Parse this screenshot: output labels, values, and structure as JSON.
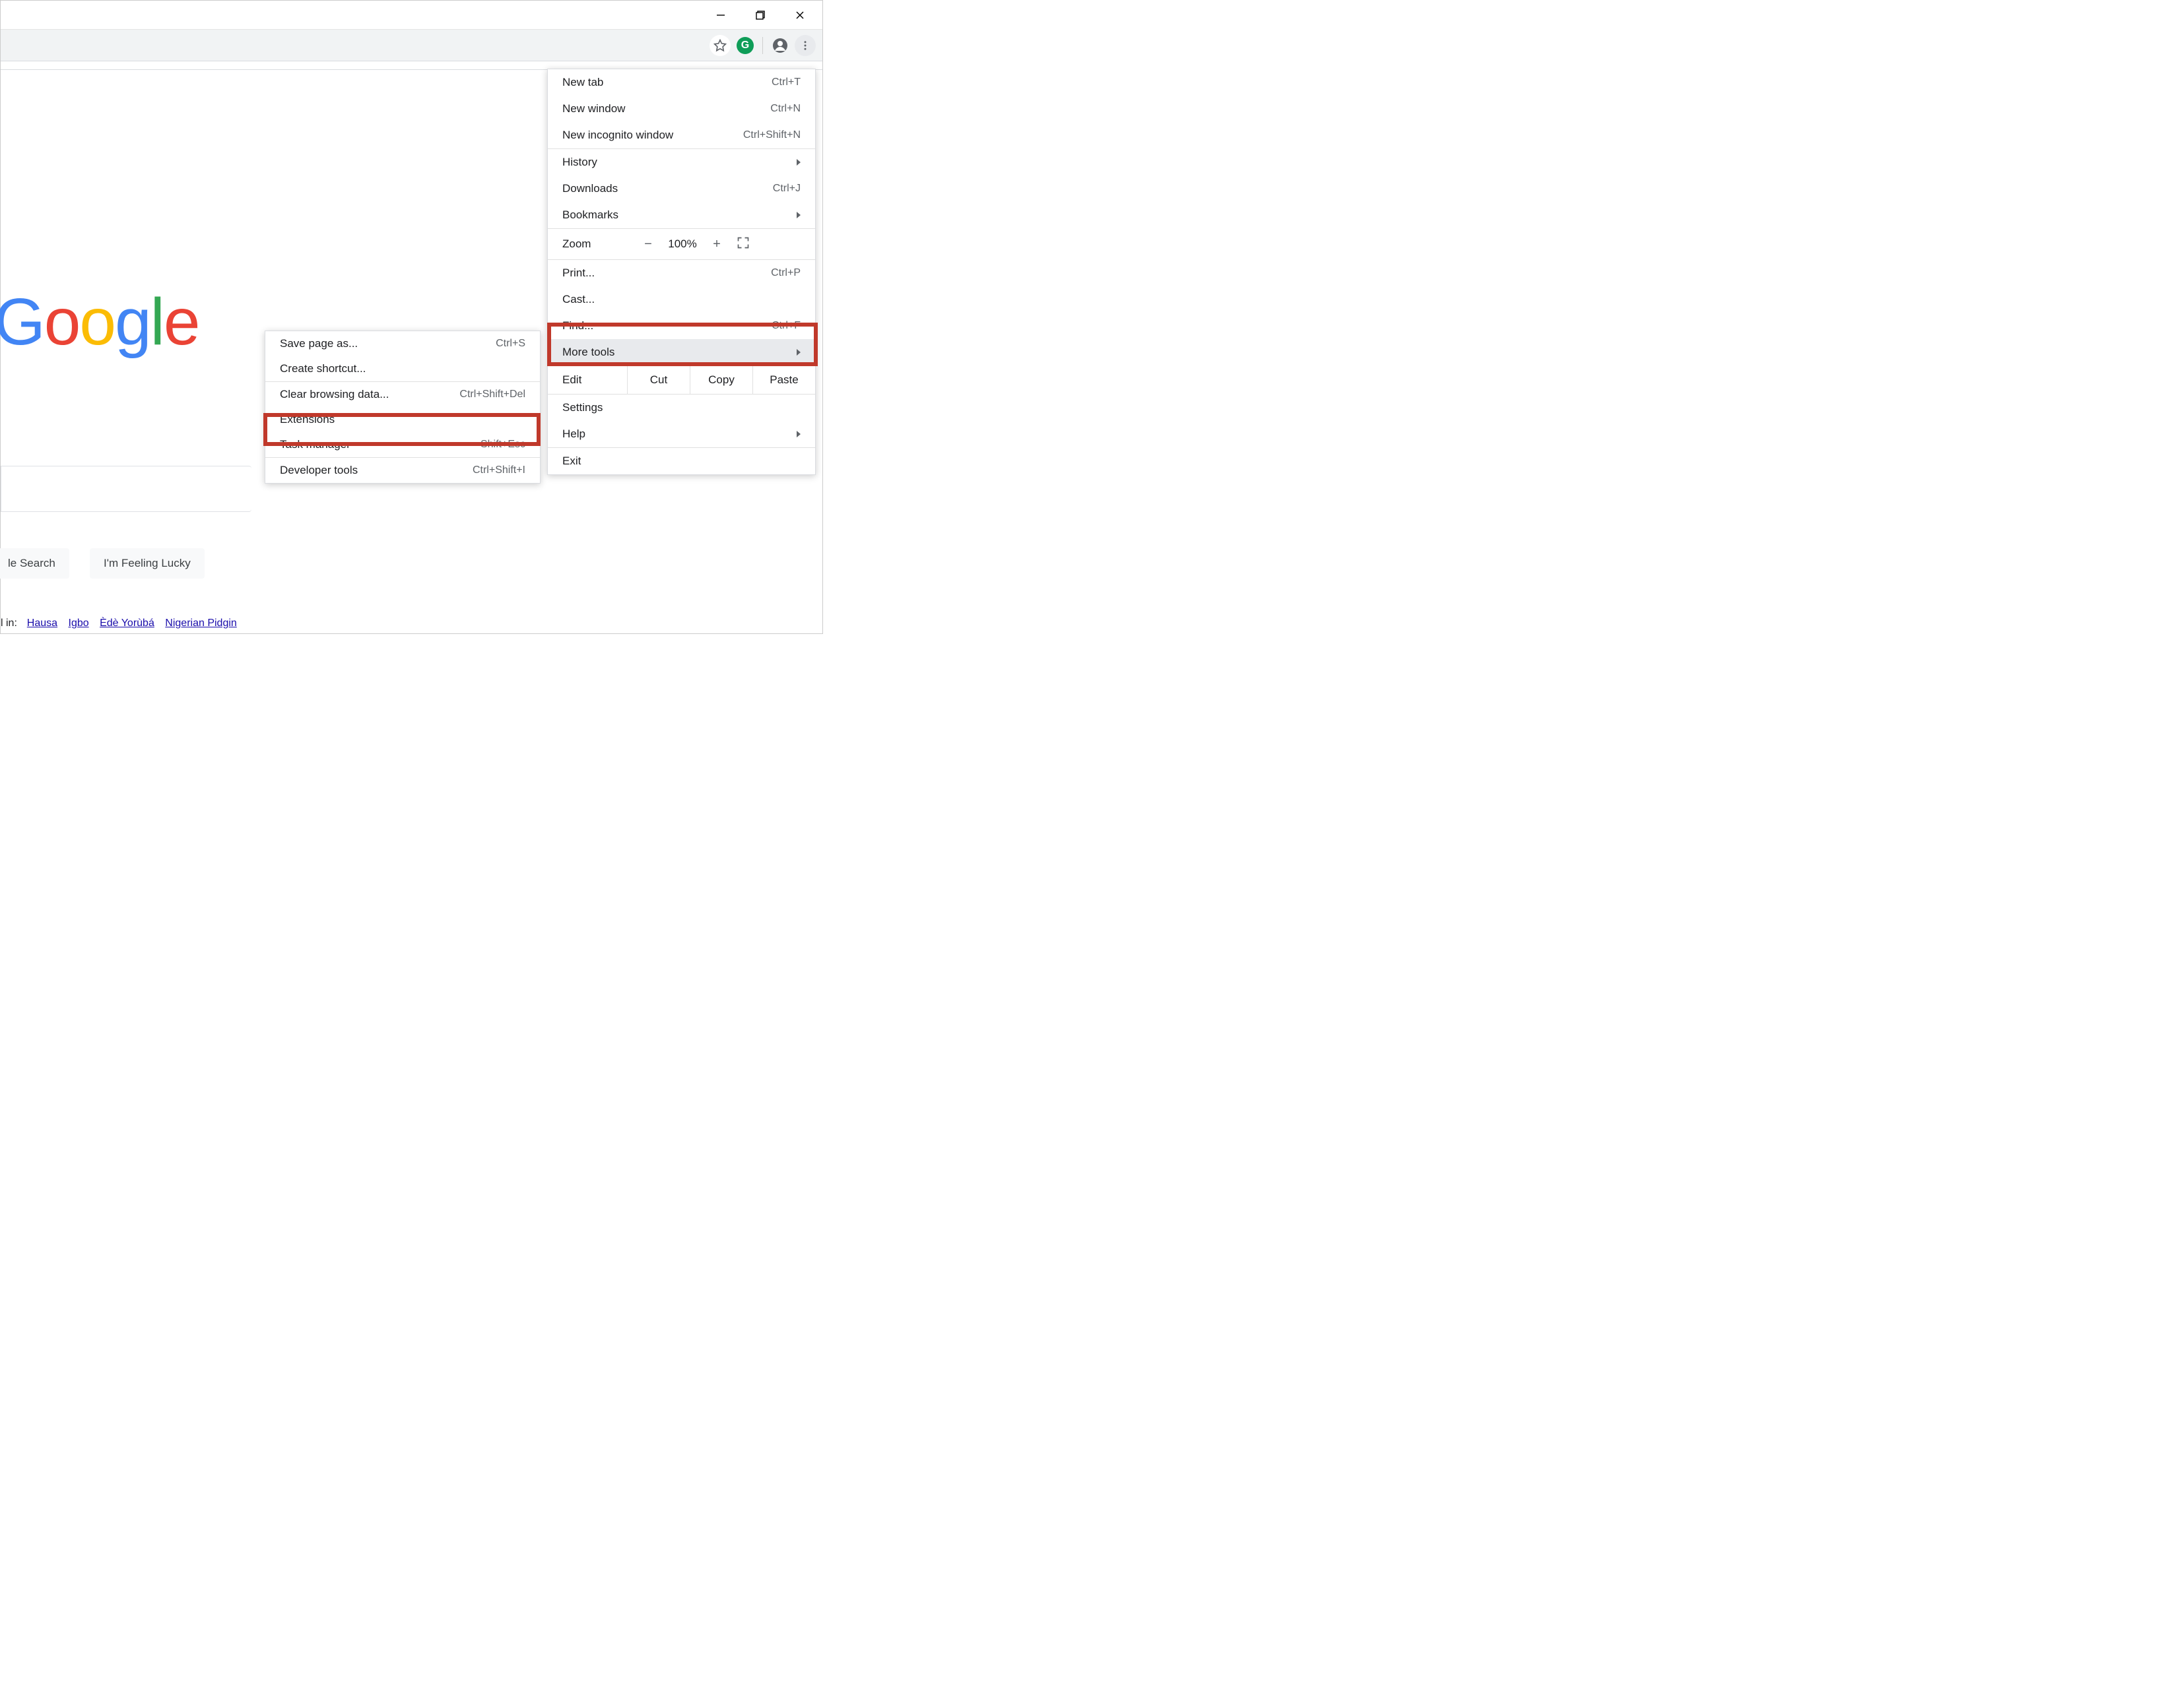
{
  "window": {
    "min": "Minimize",
    "max": "Maximize",
    "close": "Close"
  },
  "toolbar": {
    "star": "Bookmark",
    "ext_badge": "G",
    "profile": "Profile",
    "more": "Customize and control Google Chrome"
  },
  "page": {
    "logo": [
      "G",
      "o",
      "o",
      "g",
      "l",
      "e"
    ],
    "search_btn_left": "le Search",
    "lucky_btn": "I'm Feeling Lucky",
    "lang_prefix": "l in:",
    "langs": [
      "Hausa",
      "Igbo",
      "Èdè Yorùbá",
      "Nigerian Pidgin"
    ]
  },
  "menu": {
    "new_tab": {
      "label": "New tab",
      "accel": "Ctrl+T"
    },
    "new_window": {
      "label": "New window",
      "accel": "Ctrl+N"
    },
    "new_incognito": {
      "label": "New incognito window",
      "accel": "Ctrl+Shift+N"
    },
    "history": {
      "label": "History"
    },
    "downloads": {
      "label": "Downloads",
      "accel": "Ctrl+J"
    },
    "bookmarks": {
      "label": "Bookmarks"
    },
    "zoom": {
      "label": "Zoom",
      "minus": "−",
      "value": "100%",
      "plus": "+"
    },
    "print": {
      "label": "Print...",
      "accel": "Ctrl+P"
    },
    "cast": {
      "label": "Cast..."
    },
    "find": {
      "label": "Find...",
      "accel": "Ctrl+F"
    },
    "more_tools": {
      "label": "More tools"
    },
    "edit": {
      "label": "Edit",
      "cut": "Cut",
      "copy": "Copy",
      "paste": "Paste"
    },
    "settings": {
      "label": "Settings"
    },
    "help": {
      "label": "Help"
    },
    "exit": {
      "label": "Exit"
    }
  },
  "submenu": {
    "save_as": {
      "label": "Save page as...",
      "accel": "Ctrl+S"
    },
    "create_shortcut": {
      "label": "Create shortcut..."
    },
    "clear_data": {
      "label": "Clear browsing data...",
      "accel": "Ctrl+Shift+Del"
    },
    "extensions": {
      "label": "Extensions"
    },
    "task_manager": {
      "label": "Task manager",
      "accel": "Shift+Esc"
    },
    "dev_tools": {
      "label": "Developer tools",
      "accel": "Ctrl+Shift+I"
    }
  }
}
